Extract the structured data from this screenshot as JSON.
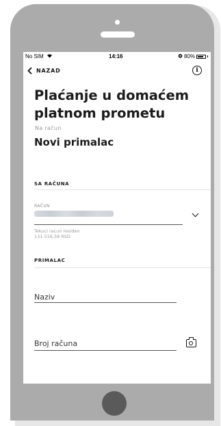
{
  "statusbar": {
    "carrier": "No SIM",
    "wifi_icon": "wifi-icon",
    "time": "14:16",
    "alarm_icon": "alarm-icon",
    "battery_percent": "80%",
    "battery_level": 0.8
  },
  "nav": {
    "back_label": "NAZAD",
    "back_icon": "chevron-left-icon",
    "info_icon": "info-icon",
    "info_glyph": "i"
  },
  "page": {
    "title": "Plaćanje u domaćem platnom prometu",
    "subtitle": "Na račun",
    "recipient_heading": "Novi primalac"
  },
  "from_account": {
    "section_label": "SA RAČUNA",
    "field_label": "RAČUN",
    "account_type": "Tekuci racun residen",
    "balance": "131.516,58 RSD",
    "dropdown_icon": "chevron-down-icon"
  },
  "recipient": {
    "section_label": "PRIMALAC",
    "name_placeholder": "Naziv",
    "account_placeholder": "Broj računa",
    "camera_icon": "camera-icon"
  },
  "colors": {
    "phone_body": "#ababab",
    "home_button": "#5a5a5a",
    "text_primary": "#1b1b1b",
    "text_muted": "#9a9a9a"
  }
}
